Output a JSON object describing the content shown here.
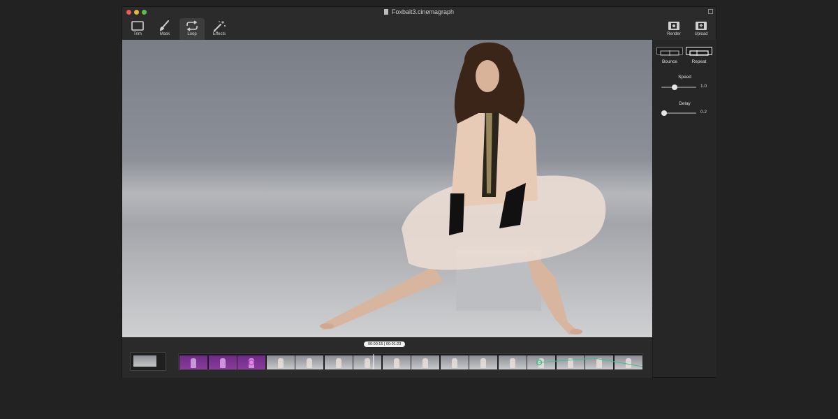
{
  "window": {
    "title": "Foxbait3.cinemagraph"
  },
  "toolbar": {
    "tools": [
      {
        "label": "Trim",
        "icon": "trim-icon"
      },
      {
        "label": "Mask",
        "icon": "brush-icon"
      },
      {
        "label": "Loop",
        "icon": "loop-icon",
        "active": true
      },
      {
        "label": "Effects",
        "icon": "magic-wand-icon"
      }
    ],
    "actions": [
      {
        "label": "Render",
        "icon": "film-icon"
      },
      {
        "label": "Upload",
        "icon": "film-upload-icon"
      }
    ]
  },
  "inspector": {
    "loop_modes": [
      {
        "label": "Bounce",
        "selected": false
      },
      {
        "label": "Repeat",
        "selected": true
      }
    ],
    "speed": {
      "label": "Speed",
      "value": "1.0",
      "level": 0.35
    },
    "delay": {
      "label": "Delay",
      "value": "0.2",
      "level": 0.0
    }
  },
  "timeline": {
    "current_time": "00:00:15",
    "total_time": "00:01:23",
    "separator": "|",
    "playhead_fraction": 0.42,
    "frame_count": 16,
    "masked_frames": 3
  },
  "colors": {
    "accent_purple": "#8a3c9c",
    "accent_green": "#3fbf8f",
    "mask_magenta": "#d23ad6"
  }
}
